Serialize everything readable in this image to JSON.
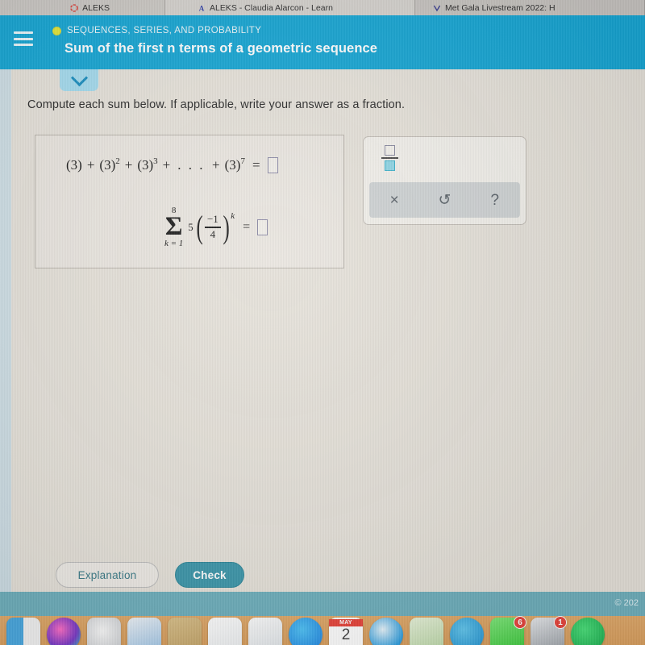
{
  "browser": {
    "tabs": [
      {
        "label": "ALEKS",
        "favicon": "aleks-red-icon",
        "active": false
      },
      {
        "label": "ALEKS - Claudia Alarcon - Learn",
        "favicon": "aleks-blue-a-icon",
        "active": true
      },
      {
        "label": "Met Gala Livestream 2022: H",
        "favicon": "youtube-icon",
        "active": false
      }
    ]
  },
  "header": {
    "menu_icon": "hamburger-icon",
    "kicker": "SEQUENCES, SERIES, AND PROBABILITY",
    "title": "Sum of the first n terms of a geometric sequence",
    "bg_color": "#16a6d4",
    "dot_color": "#e3e63a"
  },
  "collapse_tab": {
    "icon": "chevron-down-icon"
  },
  "main": {
    "instruction": "Compute each sum below. If applicable, write your answer as a fraction.",
    "problems": [
      {
        "id": "geometric-series-expanded",
        "terms": [
          "(3)",
          "(3)",
          "(3)",
          "(3)"
        ],
        "exponents": [
          "",
          "2",
          "3",
          "7"
        ],
        "ellipsis": ". . .",
        "plus": "+",
        "equals": "=",
        "answer_value": ""
      },
      {
        "id": "summation-notation",
        "sigma": "Σ",
        "upper_limit": "8",
        "lower_limit": "k = 1",
        "coefficient": "5",
        "numerator": "−1",
        "denominator": "4",
        "exponent": "k",
        "equals": "=",
        "answer_value": ""
      }
    ]
  },
  "palette": {
    "fraction_template": {
      "name": "fraction-template",
      "numerator_placeholder": "",
      "denominator_placeholder": "",
      "highlight_color": "#8fd6e6"
    },
    "buttons": [
      {
        "name": "clear-button",
        "glyph": "×"
      },
      {
        "name": "undo-button",
        "glyph": "↺"
      },
      {
        "name": "help-button",
        "glyph": "?"
      }
    ]
  },
  "actions": {
    "explanation_label": "Explanation",
    "check_label": "Check",
    "check_color": "#3d97ab"
  },
  "footer": {
    "copyright": "© 202",
    "bar_color": "#6fb0bd"
  },
  "dock": {
    "items": [
      {
        "name": "finder-icon",
        "badge": ""
      },
      {
        "name": "siri-icon",
        "badge": ""
      },
      {
        "name": "launchpad-icon",
        "badge": ""
      },
      {
        "name": "photos-icon",
        "badge": ""
      },
      {
        "name": "contacts-icon",
        "badge": ""
      },
      {
        "name": "notes-icon",
        "badge": ""
      },
      {
        "name": "keynote-icon",
        "badge": ""
      },
      {
        "name": "app-store-icon",
        "badge": ""
      },
      {
        "name": "calendar-icon",
        "badge": "",
        "month": "MAY",
        "day": "2"
      },
      {
        "name": "safari-icon",
        "badge": ""
      },
      {
        "name": "maps-icon",
        "badge": ""
      },
      {
        "name": "mail-icon",
        "badge": ""
      },
      {
        "name": "messages-icon",
        "badge": "6"
      },
      {
        "name": "system-preferences-icon",
        "badge": "1"
      },
      {
        "name": "spotify-icon",
        "badge": ""
      }
    ]
  }
}
